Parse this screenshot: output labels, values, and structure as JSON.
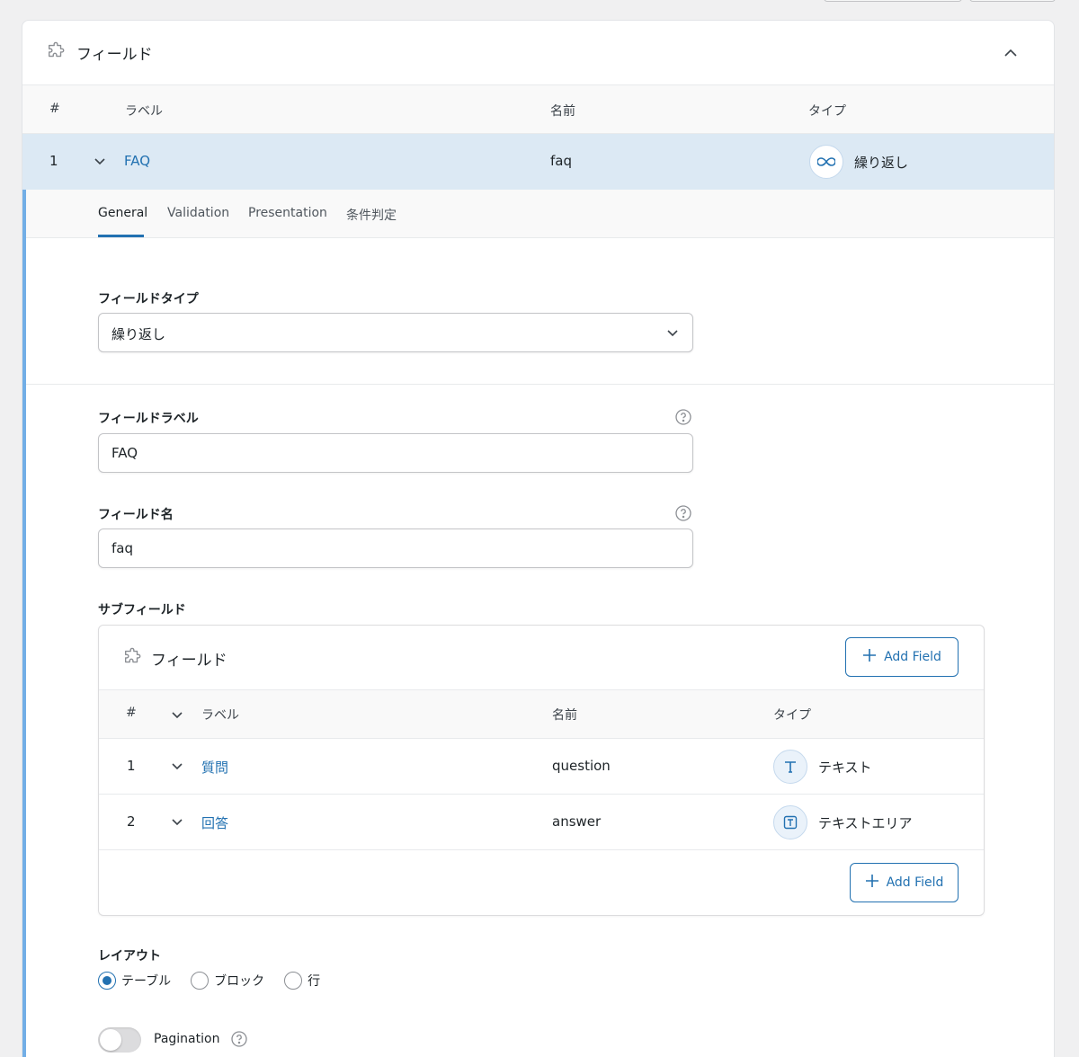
{
  "panel": {
    "title": "フィールド",
    "columns": {
      "number": "#",
      "label": "ラベル",
      "name": "名前",
      "type": "タイプ"
    },
    "row": {
      "number": "1",
      "label": "FAQ",
      "name": "faq",
      "type": "繰り返し",
      "type_icon": "infinity-icon"
    }
  },
  "tabs": [
    "General",
    "Validation",
    "Presentation",
    "条件判定"
  ],
  "active_tab": "General",
  "form": {
    "field_type": {
      "label": "フィールドタイプ",
      "value": "繰り返し"
    },
    "field_label": {
      "label": "フィールドラベル",
      "value": "FAQ"
    },
    "field_name": {
      "label": "フィールド名",
      "value": "faq"
    }
  },
  "subfields": {
    "label": "サブフィールド",
    "title": "フィールド",
    "add_field": "Add Field",
    "columns": {
      "number": "#",
      "label": "ラベル",
      "name": "名前",
      "type": "タイプ"
    },
    "rows": [
      {
        "number": "1",
        "label": "質問",
        "name": "question",
        "type": "テキスト",
        "type_icon": "text-icon"
      },
      {
        "number": "2",
        "label": "回答",
        "name": "answer",
        "type": "テキストエリア",
        "type_icon": "textarea-icon"
      }
    ]
  },
  "layout": {
    "label": "レイアウト",
    "options": [
      "テーブル",
      "ブロック",
      "行"
    ],
    "selected": "テーブル"
  },
  "pagination": {
    "label": "Pagination",
    "enabled": false
  },
  "colors": {
    "accent": "#2271b1",
    "active_row": "#dce9f4",
    "expanded_border": "#72aee6"
  }
}
